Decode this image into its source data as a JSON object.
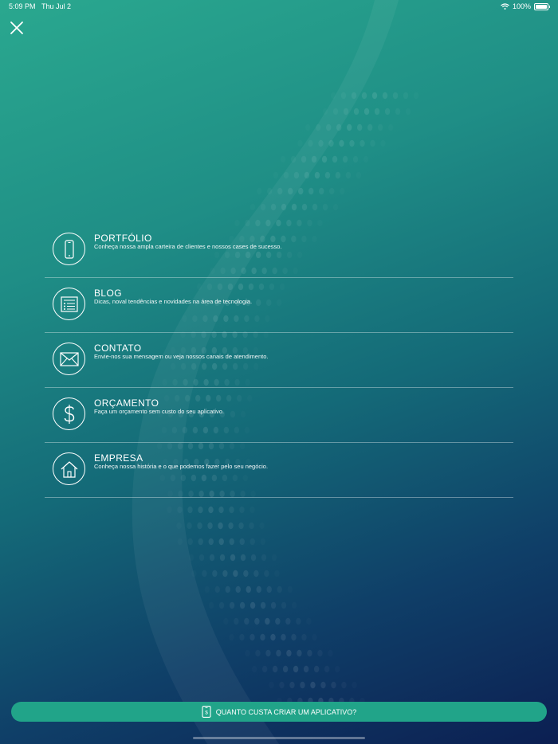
{
  "status_bar": {
    "time": "5:09 PM",
    "date": "Thu Jul 2",
    "battery": "100%"
  },
  "menu": {
    "items": [
      {
        "title": "PORTFÓLIO",
        "description": "Conheça nossa ampla carteira de clientes e nossos cases de sucesso.",
        "icon": "smartphone-icon"
      },
      {
        "title": "BLOG",
        "description": "Dicas, noval tendências e novidades na área de tecnologia.",
        "icon": "list-icon"
      },
      {
        "title": "CONTATO",
        "description": "Envie-nos sua mensagem ou veja nossos canais de atendimento.",
        "icon": "envelope-icon"
      },
      {
        "title": "ORÇAMENTO",
        "description": "Faça um orçamento sem custo do seu aplicativo.",
        "icon": "dollar-icon"
      },
      {
        "title": "EMPRESA",
        "description": "Conheça nossa história e o que podemos fazer pelo seu negócio.",
        "icon": "house-icon"
      }
    ]
  },
  "cta": {
    "label": "QUANTO CUSTA CRIAR UM APLICATIVO?",
    "icon": "phone-dollar-icon"
  },
  "colors": {
    "cta_background": "#21a489",
    "gradient_top": "#2aa88f",
    "gradient_bottom": "#0c1f52"
  }
}
